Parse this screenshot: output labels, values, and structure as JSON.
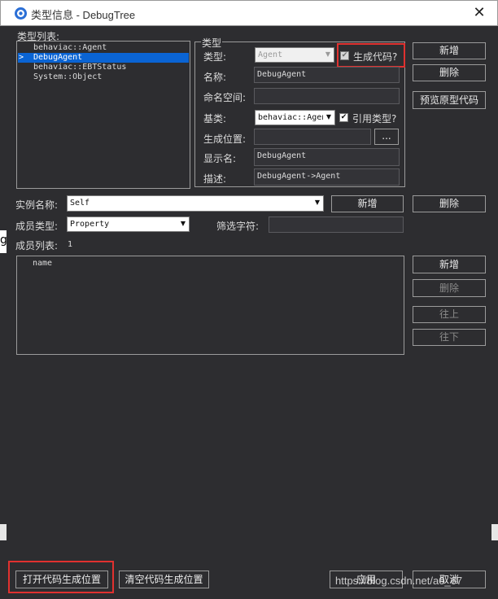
{
  "window": {
    "title": "类型信息 - DebugTree",
    "close_glyph": "✕",
    "app_icon": "behaviac-app-icon",
    "close_icon": "close-icon"
  },
  "type_list": {
    "label": "类型列表:",
    "items": [
      "behaviac::Agent",
      "DebugAgent",
      "behaviac::EBTStatus",
      "System::Object"
    ],
    "selected_index": 1,
    "selected_marker": ">"
  },
  "type_group": {
    "legend": "类型",
    "type_label": "类型:",
    "type_value": "Agent",
    "generate_code_label": "生成代码?",
    "generate_code_checked": true,
    "name_label": "名称:",
    "name_value": "DebugAgent",
    "namespace_label": "命名空间:",
    "namespace_value": "",
    "base_label": "基类:",
    "base_value": "behaviac::Agent",
    "ref_type_label": "引用类型?",
    "ref_type_checked": true,
    "gen_location_label": "生成位置:",
    "gen_location_value": "",
    "browse_label": "...",
    "display_name_label": "显示名:",
    "display_name_value": "DebugAgent",
    "description_label": "描述:",
    "description_value": "DebugAgent->Agent"
  },
  "right_buttons": {
    "add": "新增",
    "delete": "删除",
    "preview": "预览原型代码"
  },
  "instance": {
    "label": "实例名称:",
    "value": "Self",
    "add": "新增",
    "delete": "删除"
  },
  "member": {
    "type_label": "成员类型:",
    "type_value": "Property",
    "filter_label": "筛选字符:",
    "filter_value": "",
    "list_label": "成员列表:",
    "count": "1",
    "items": [
      "name"
    ],
    "buttons": {
      "add": "新增",
      "delete": "删除",
      "up": "往上",
      "down": "往下"
    }
  },
  "left_edge_text": "g",
  "bottom": {
    "open_gen": "打开代码生成位置",
    "clear_gen": "清空代码生成位置",
    "apply": "应用",
    "cancel": "取消"
  },
  "watermark": "https://blog.csdn.net/a0_67",
  "colors": {
    "background": "#2d2d30",
    "selection": "#0a64d4",
    "highlight": "#e0312f"
  }
}
